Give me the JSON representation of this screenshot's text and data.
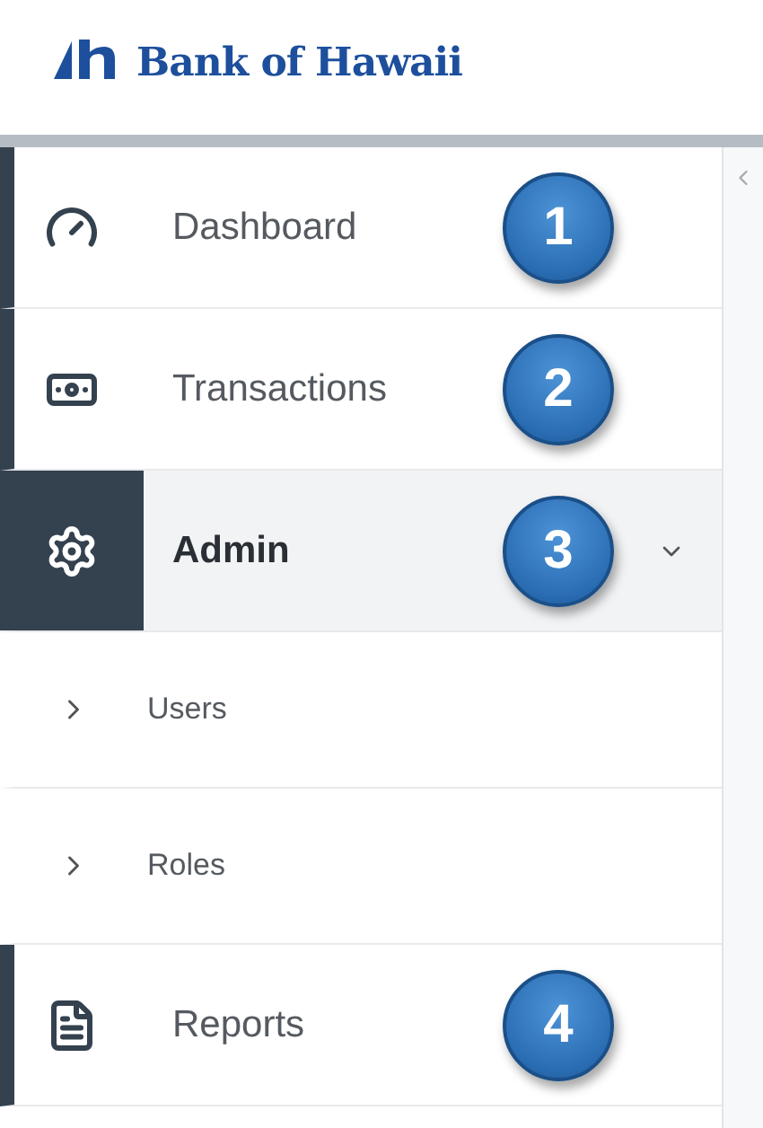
{
  "logo": {
    "text": "Bank of Hawaii"
  },
  "nav": [
    {
      "kind": "main",
      "label": "Dashboard",
      "selected": false,
      "badge": "1"
    },
    {
      "kind": "main",
      "label": "Transactions",
      "selected": false,
      "badge": "2"
    },
    {
      "kind": "main",
      "label": "Admin",
      "selected": true,
      "expanded": true,
      "badge": "3"
    },
    {
      "kind": "sub",
      "label": "Users",
      "selected": false
    },
    {
      "kind": "sub",
      "label": "Roles",
      "selected": false
    },
    {
      "kind": "main",
      "label": "Reports",
      "selected": false,
      "badge": "4"
    }
  ]
}
